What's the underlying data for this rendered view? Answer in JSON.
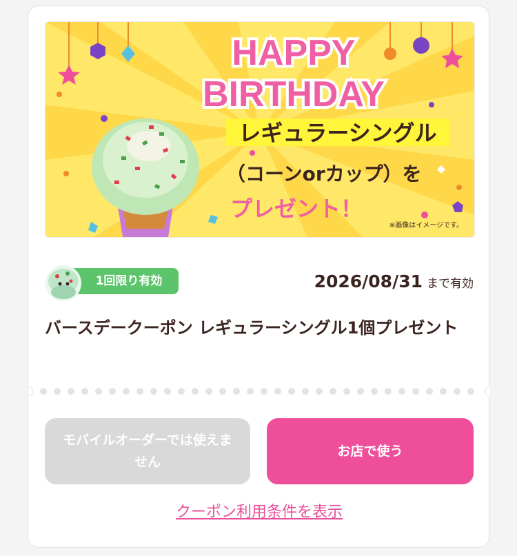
{
  "banner": {
    "headline_1": "HAPPY",
    "headline_2": "BIRTHDAY",
    "line_1": "レギュラーシングル",
    "line_2": "（コーンorカップ）を",
    "line_3": "プレゼント！",
    "note": "※画像はイメージです。"
  },
  "coupon": {
    "badge": "1回限り有効",
    "expiry_date": "2026/08/31",
    "expiry_suffix": "まで有効",
    "title": "バースデークーポン レギュラーシングル1個プレゼント"
  },
  "actions": {
    "mobile_order_label": "モバイルオーダーでは使えません",
    "use_in_store_label": "お店で使う",
    "terms_link": "クーポン利用条件を表示"
  },
  "colors": {
    "pink": "#ef4f9a",
    "badge_green": "#5cc46a",
    "disabled_gray": "#d9d9d9",
    "banner_yellow": "#ffe15a",
    "text_brown": "#3b2420"
  }
}
